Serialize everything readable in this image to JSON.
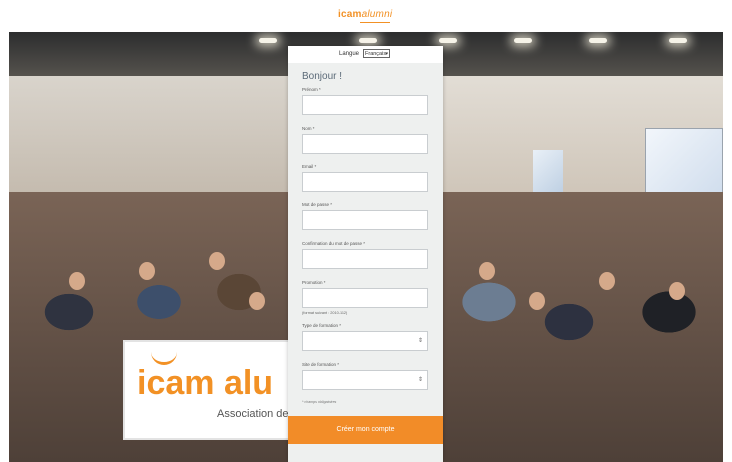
{
  "brand": {
    "name": "icam",
    "suffix": "alumni",
    "accent": "#f29125"
  },
  "language": {
    "label": "Langue",
    "selected": "Français"
  },
  "form": {
    "greeting": "Bonjour !",
    "fields": [
      {
        "label": "Prénom *",
        "value": ""
      },
      {
        "label": "Nom *",
        "value": ""
      },
      {
        "label": "Email *",
        "value": ""
      },
      {
        "label": "Mot de passe *",
        "value": ""
      },
      {
        "label": "Confirmation du mot de passe *",
        "value": ""
      },
      {
        "label": "Promotion *",
        "value": ""
      },
      {
        "label": "Type de formation *",
        "value": ""
      },
      {
        "label": "Site de formation *",
        "value": ""
      }
    ],
    "promotion_hint": "(format suivant : 2010-112)",
    "required_note": "* champs obligatoires",
    "submit_label": "Créer mon compte"
  },
  "background": {
    "banner_text": "icam alu",
    "banner_subtitle": "Association de"
  }
}
